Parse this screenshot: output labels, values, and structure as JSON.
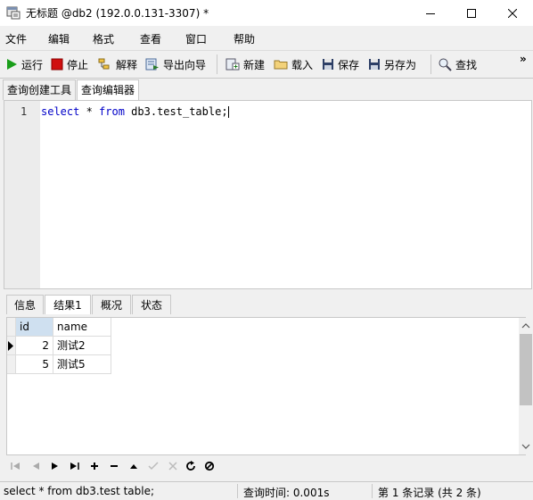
{
  "window": {
    "title": "无标题 @db2 (192.0.0.131-3307) *"
  },
  "menu": [
    "文件",
    "编辑",
    "格式",
    "查看",
    "窗口",
    "帮助"
  ],
  "toolbar": {
    "run": "运行",
    "stop": "停止",
    "explain": "解释",
    "export_wizard": "导出向导",
    "new": "新建",
    "load": "载入",
    "save": "保存",
    "save_as": "另存为",
    "find": "查找",
    "overflow": "»"
  },
  "main_tabs": [
    "查询创建工具",
    "查询编辑器"
  ],
  "editor": {
    "line_number": "1",
    "sql": {
      "kw1": "select",
      "mid": " * ",
      "kw2": "from",
      "rest": " db3.test_table;"
    }
  },
  "result_tabs": [
    "信息",
    "结果1",
    "概况",
    "状态"
  ],
  "grid": {
    "columns": [
      "id",
      "name"
    ],
    "rows": [
      {
        "id": "2",
        "name": "测试2"
      },
      {
        "id": "5",
        "name": "测试5"
      }
    ]
  },
  "status": {
    "sql": "select * from db3.test table;",
    "query_time": "查询时间: 0.001s",
    "record": "第 1 条记录 (共 2 条)"
  },
  "colors": {
    "keyword": "#0000c8",
    "run_green": "#1a9e1a",
    "stop_red": "#d01010"
  }
}
